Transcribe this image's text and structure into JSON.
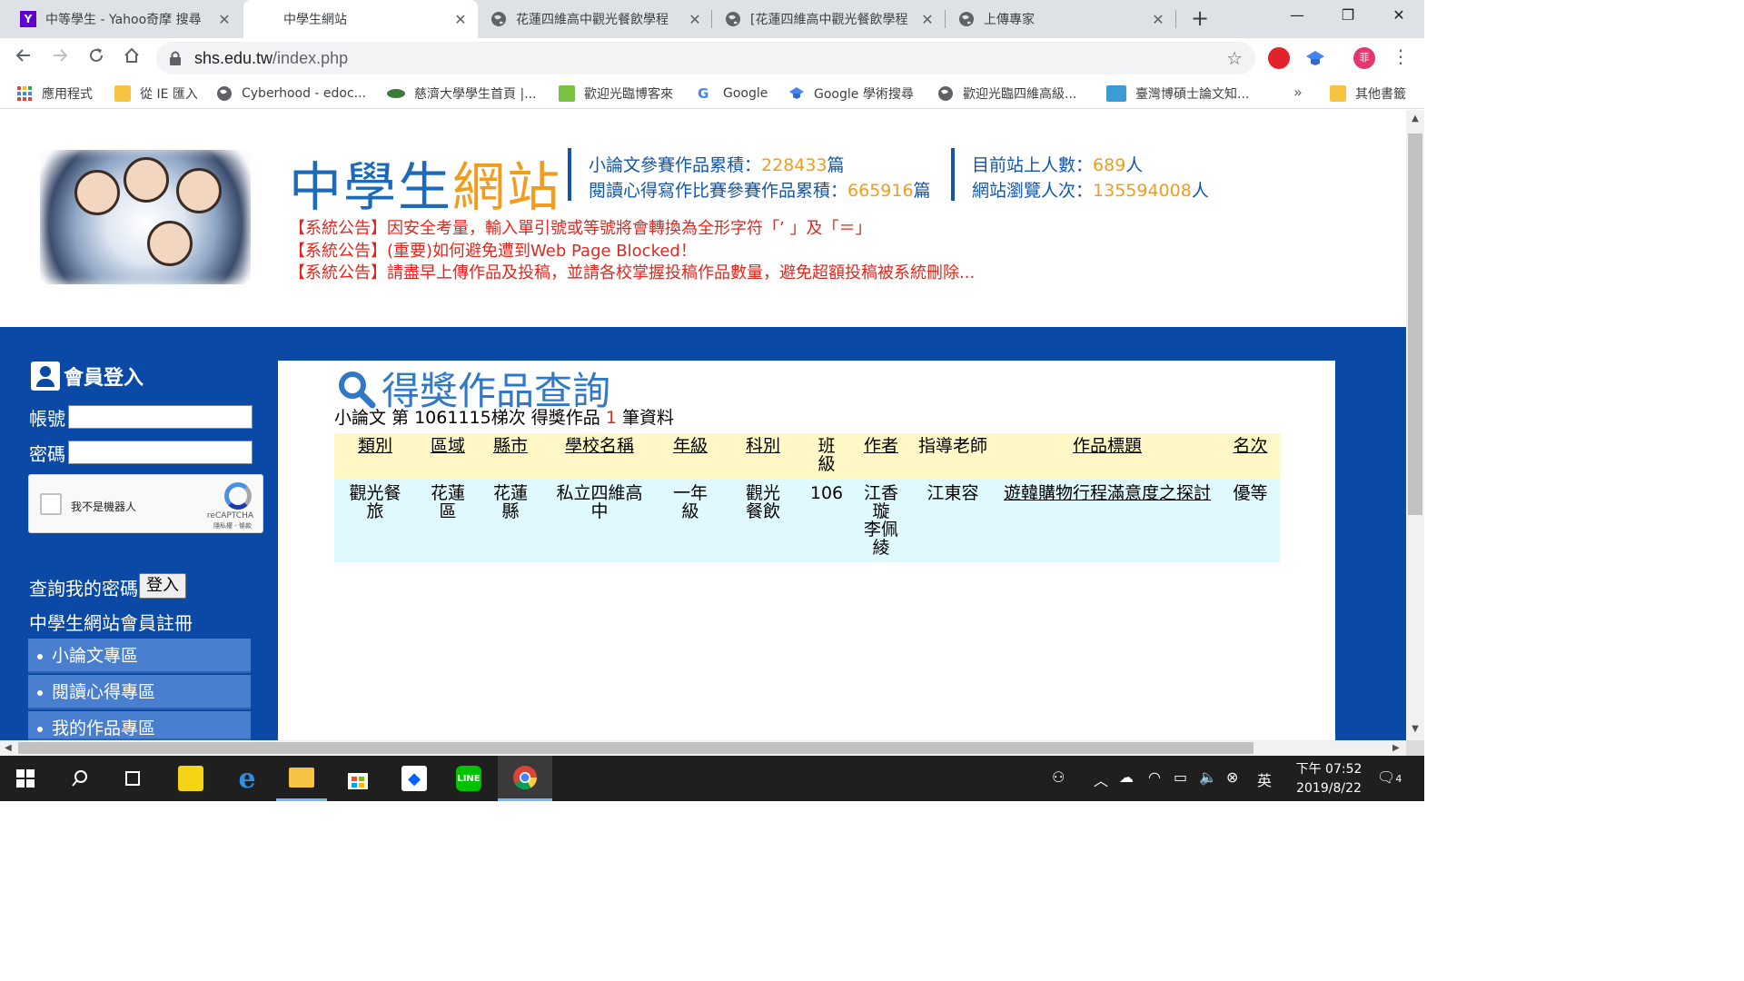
{
  "browser": {
    "tabs": [
      {
        "title": "中等學生 - Yahoo奇摩 搜尋",
        "favicon": "yahoo-icon"
      },
      {
        "title": "中學生網站",
        "favicon": "none"
      },
      {
        "title": "花蓮四維高中觀光餐飲學程",
        "favicon": "globe-icon"
      },
      {
        "title": "[花蓮四維高中觀光餐飲學程",
        "favicon": "globe-icon"
      },
      {
        "title": "上傳專家",
        "favicon": "globe-icon"
      }
    ],
    "url_host": "shs.edu.tw",
    "url_path": "/index.php",
    "avatar_text": "菲",
    "bookmarks": [
      {
        "label": "應用程式",
        "icon": "apps-grid-icon"
      },
      {
        "label": "從 IE 匯入",
        "icon": "folder-icon"
      },
      {
        "label": "Cyberhood - edoc...",
        "icon": "globe-icon"
      },
      {
        "label": "慈濟大學學生首頁 |...",
        "icon": "green-leaf-icon"
      },
      {
        "label": "歡迎光臨博客來",
        "icon": "green-box-icon"
      },
      {
        "label": "Google",
        "icon": "google-icon"
      },
      {
        "label": "Google 學術搜尋",
        "icon": "scholar-icon"
      },
      {
        "label": "歡迎光臨四維高級...",
        "icon": "globe-icon"
      },
      {
        "label": "臺灣博碩士論文知...",
        "icon": "ndltd-icon"
      }
    ],
    "bookmarks_more": "»",
    "other_bookmarks": "其他書籤"
  },
  "header": {
    "logo_part1": "中學生",
    "logo_part2": "網站",
    "stat1_label": "小論文參賽作品累積：",
    "stat1_value": "228433",
    "stat1_unit": "篇",
    "stat2_label": "閱讀心得寫作比賽參賽作品累積：",
    "stat2_value": "665916",
    "stat2_unit": "篇",
    "stat3_label": "目前站上人數：",
    "stat3_value": "689",
    "stat3_unit": "人",
    "stat4_label": "網站瀏覽人次：",
    "stat4_value": "135594008",
    "stat4_unit": "人",
    "notices": [
      "【系統公告】因安全考量，輸入單引號或等號將會轉換為全形字符「’ 」及「＝」",
      "【系統公告】(重要)如何避免遭到Web Page Blocked！",
      "【系統公告】請盡早上傳作品及投稿，並請各校掌握投稿作品數量，避免超額投稿被系統刪除..."
    ]
  },
  "sidebar": {
    "login_title": "會員登入",
    "account_label": "帳號",
    "password_label": "密碼",
    "recaptcha_text": "我不是機器人",
    "recaptcha_brand": "reCAPTCHA",
    "recaptcha_privacy": "隱私權 - 條款",
    "forgot_password": "查詢我的密碼",
    "login_button": "登入",
    "register": "中學生網站會員註冊",
    "menu": [
      "小論文專區",
      "閱讀心得專區",
      "我的作品專區"
    ]
  },
  "main": {
    "title": "得獎作品查詢",
    "summary_prefix": "小論文 第 ",
    "batch": "1061115",
    "summary_mid": "梯次 得獎作品 ",
    "count": "1",
    "summary_suffix": " 筆資料",
    "columns": [
      "類別",
      "區域",
      "縣市",
      "學校名稱",
      "年級",
      "科別",
      "班級",
      "作者",
      "指導老師",
      "作品標題",
      "名次"
    ],
    "rows": [
      [
        "觀光餐旅",
        "花蓮區",
        "花蓮縣",
        "私立四維高中",
        "一年級",
        "觀光餐飲",
        "106",
        "江香璇\n李佩綾",
        "江東容",
        "遊韓購物行程滿意度之探討",
        "優等"
      ]
    ]
  },
  "taskbar": {
    "time": "下午 07:52",
    "date": "2019/8/22",
    "notifications": "4",
    "ime": "英"
  },
  "colors": {
    "brand_blue": "#0a4aa6",
    "logo_blue": "#1d6bb8",
    "logo_orange": "#f29c1f",
    "notice_red": "#e0271d",
    "table_header": "#fff8c6",
    "table_row": "#dff9fe"
  }
}
